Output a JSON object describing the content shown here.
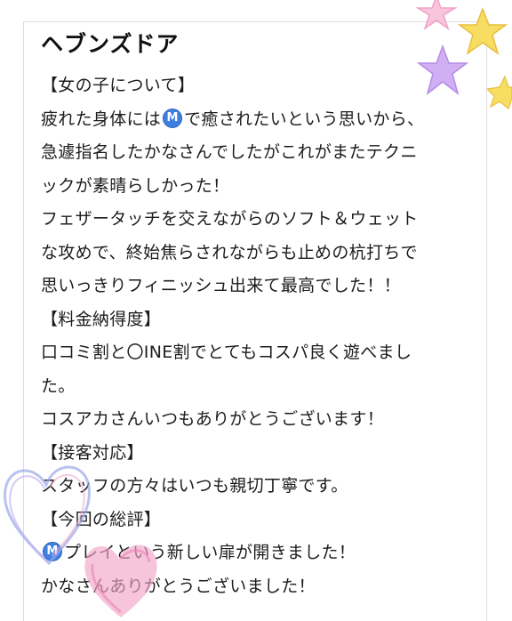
{
  "review": {
    "title": "ヘブンズドア",
    "lines": [
      {
        "text": "【女の子について】"
      },
      {
        "before": "疲れた身体には",
        "badge": "M",
        "after": "で癒されたいという思いから、"
      },
      {
        "text": "急遽指名したかなさんでしたがこれがまたテクニ"
      },
      {
        "text": "ックが素晴らしかった！"
      },
      {
        "text": "フェザータッチを交えながらのソフト＆ウェット"
      },
      {
        "text": "な攻めで、終始焦らされながらも止めの杭打ちで"
      },
      {
        "text": "思いっきりフィニッシュ出来て最高でした！！"
      },
      {
        "text": "【料金納得度】"
      },
      {
        "text": "口コミ割と〇INE割でとてもコスパ良く遊べまし"
      },
      {
        "text": "た。"
      },
      {
        "text": "コスアカさんいつもありがとうございます！"
      },
      {
        "text": "【接客対応】"
      },
      {
        "text": "スタッフの方々はいつも親切丁寧です。"
      },
      {
        "text": "【今回の総評】"
      },
      {
        "before": "",
        "badge": "M",
        "after": "プレイという新しい扉が開きました！"
      },
      {
        "text": "かなさんありがとうございました！"
      }
    ]
  },
  "decorations": {
    "stars": [
      "pink-star-icon",
      "yellow-star-icon",
      "purple-star-icon",
      "yellow-star-icon"
    ],
    "hearts": [
      "blue-scribble-heart-icon",
      "pink-scribble-heart-icon"
    ],
    "colors": {
      "badge": "#3e7fe0",
      "pink": "#f3a6c8",
      "yellow": "#f5d447",
      "purple": "#b98be8",
      "blue": "#9aa8e8"
    }
  }
}
